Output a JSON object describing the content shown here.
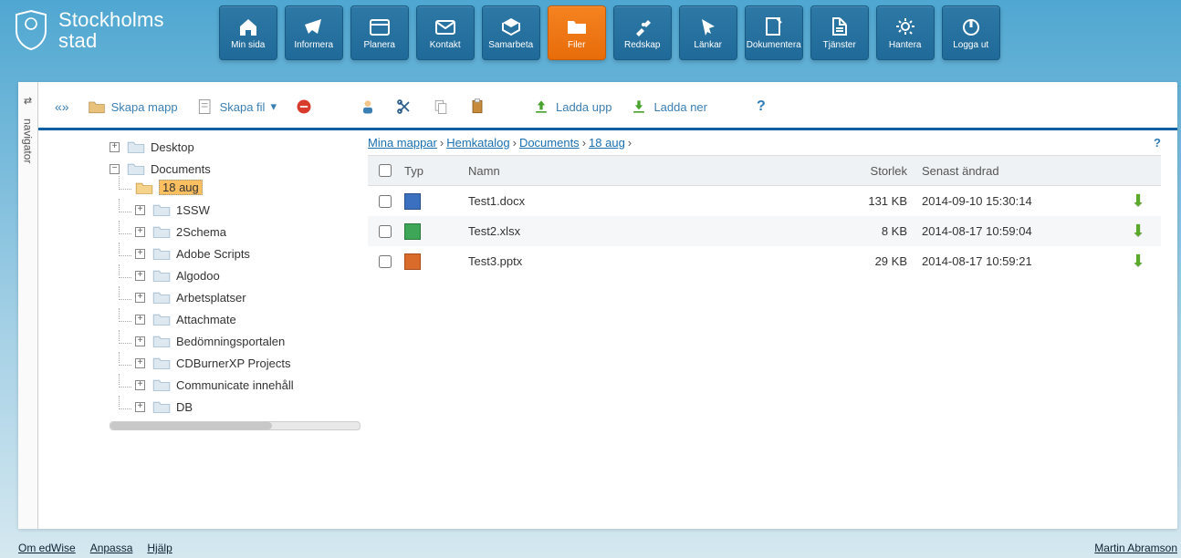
{
  "brand": {
    "line1": "Stockholms",
    "line2": "stad"
  },
  "nav": [
    {
      "key": "min-sida",
      "label": "Min sida"
    },
    {
      "key": "informera",
      "label": "Informera"
    },
    {
      "key": "planera",
      "label": "Planera"
    },
    {
      "key": "kontakt",
      "label": "Kontakt"
    },
    {
      "key": "samarbeta",
      "label": "Samarbeta"
    },
    {
      "key": "filer",
      "label": "Filer",
      "active": true
    },
    {
      "key": "redskap",
      "label": "Redskap"
    },
    {
      "key": "lankar",
      "label": "Länkar"
    },
    {
      "key": "dokumentera",
      "label": "Dokumentera"
    },
    {
      "key": "tjanster",
      "label": "Tjänster"
    },
    {
      "key": "hantera",
      "label": "Hantera"
    },
    {
      "key": "logga-ut",
      "label": "Logga ut"
    }
  ],
  "sidebar_tab": "navigator",
  "toolbar": {
    "chevrons": "«»",
    "skapa_mapp": "Skapa mapp",
    "skapa_fil": "Skapa fil",
    "ladda_upp": "Ladda upp",
    "ladda_ner": "Ladda ner"
  },
  "tree": {
    "desktop": "Desktop",
    "documents": "Documents",
    "children": [
      "18 aug",
      "1SSW",
      "2Schema",
      "Adobe Scripts",
      "Algodoo",
      "Arbetsplatser",
      "Attachmate",
      "Bedömningsportalen",
      "CDBurnerXP Projects",
      "Communicate innehåll",
      "DB"
    ],
    "selected": "18 aug"
  },
  "breadcrumb": [
    "Mina mappar",
    "Hemkatalog",
    "Documents",
    "18 aug"
  ],
  "columns": {
    "typ": "Typ",
    "namn": "Namn",
    "storlek": "Storlek",
    "senast": "Senast ändrad"
  },
  "files": [
    {
      "type": "docx",
      "name": "Test1.docx",
      "size": "131 KB",
      "mod": "2014-09-10 15:30:14"
    },
    {
      "type": "xlsx",
      "name": "Test2.xlsx",
      "size": "8 KB",
      "mod": "2014-08-17 10:59:04"
    },
    {
      "type": "pptx",
      "name": "Test3.pptx",
      "size": "29 KB",
      "mod": "2014-08-17 10:59:21"
    }
  ],
  "footer": {
    "left": [
      "Om edWise",
      "Anpassa",
      "Hjälp"
    ],
    "right": "Martin Abramson"
  }
}
